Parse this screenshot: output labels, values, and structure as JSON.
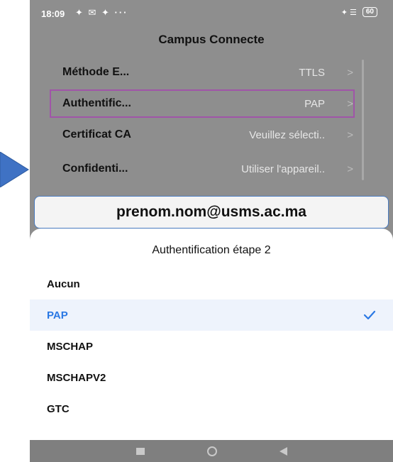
{
  "status_bar": {
    "time": "18:09",
    "left_icons": "✦ ✉ ✦ ···",
    "right_icons": "✦ ☰",
    "battery": "60"
  },
  "network_title": "Campus Connecte",
  "settings": [
    {
      "label": "Méthode E...",
      "value": "TTLS",
      "chevron": ">"
    },
    {
      "label": "Authentific...",
      "value": "PAP",
      "chevron": ">"
    },
    {
      "label": "Certificat CA",
      "value": "Veuillez sélecti..",
      "chevron": ">"
    },
    {
      "label": "Confidenti...",
      "value": "Utiliser l'appareil..",
      "chevron": ">"
    }
  ],
  "email_annotation": "prenom.nom@usms.ac.ma",
  "sheet": {
    "title": "Authentification étape 2",
    "options": [
      {
        "label": "Aucun",
        "selected": false
      },
      {
        "label": "PAP",
        "selected": true
      },
      {
        "label": "MSCHAP",
        "selected": false
      },
      {
        "label": "MSCHAPV2",
        "selected": false
      },
      {
        "label": "GTC",
        "selected": false
      }
    ]
  },
  "colors": {
    "accent": "#2a78e4",
    "highlight_border": "#a055a8",
    "pointer": "#3f72c4",
    "email_border": "#4a7bbf"
  }
}
